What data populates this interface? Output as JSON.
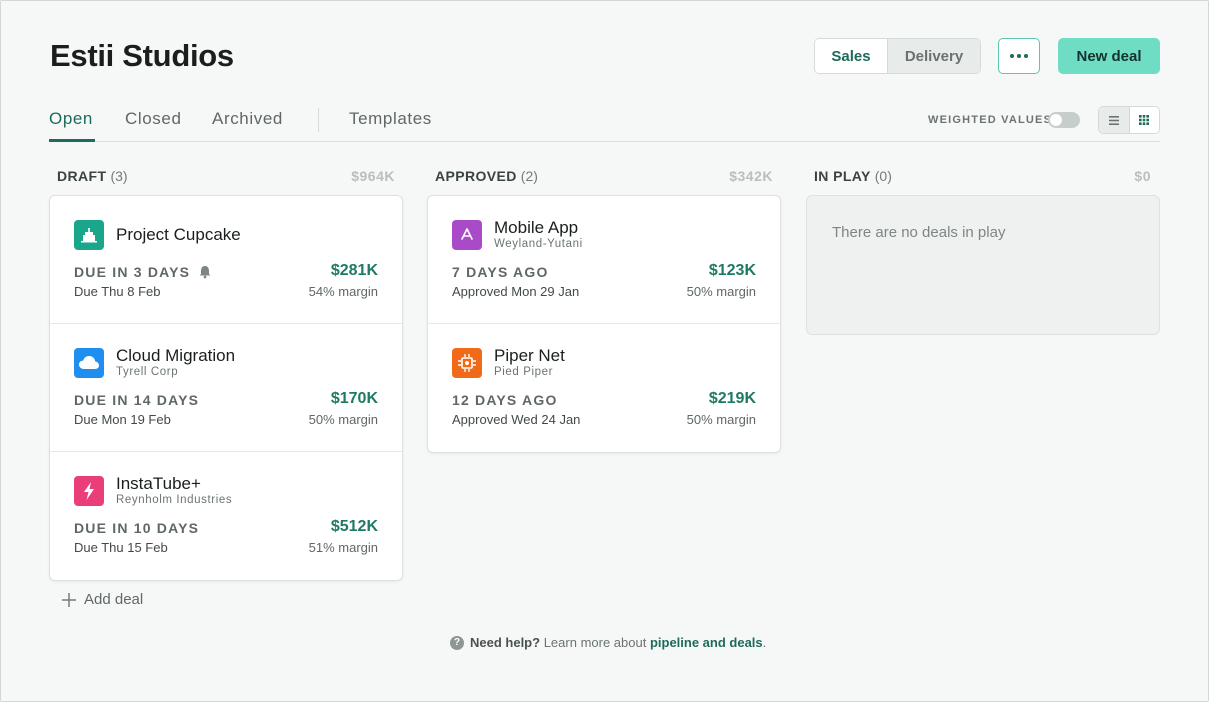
{
  "page": {
    "title": "Estii Studios"
  },
  "header": {
    "segments": [
      "Sales",
      "Delivery"
    ],
    "new_deal_label": "New deal"
  },
  "tabs": [
    "Open",
    "Closed",
    "Archived",
    "Templates"
  ],
  "view_options": {
    "weighted_label": "WEIGHTED VALUES",
    "weighted_on": false
  },
  "columns": [
    {
      "name": "DRAFT",
      "count": "(3)",
      "total": "$964K",
      "deals": [
        {
          "title": "Project Cupcake",
          "client": "",
          "due": "DUE IN 3 DAYS",
          "has_reminder": true,
          "date": "Due Thu 8 Feb",
          "amount": "$281K",
          "margin": "54% margin",
          "icon": "cake-icon",
          "color": "#1aa68a"
        },
        {
          "title": "Cloud Migration",
          "client": "Tyrell Corp",
          "due": "DUE IN 14 DAYS",
          "date": "Due Mon 19 Feb",
          "amount": "$170K",
          "margin": "50% margin",
          "icon": "cloud-icon",
          "color": "#1e8ef0"
        },
        {
          "title": "InstaTube+",
          "client": "Reynholm Industries",
          "due": "DUE IN 10 DAYS",
          "date": "Due Thu 15 Feb",
          "amount": "$512K",
          "margin": "51% margin",
          "icon": "bolt-icon",
          "color": "#ea3e7a"
        }
      ]
    },
    {
      "name": "APPROVED",
      "count": "(2)",
      "total": "$342K",
      "deals": [
        {
          "title": "Mobile App",
          "client": "Weyland-Yutani",
          "due": "7 DAYS AGO",
          "date": "Approved Mon 29 Jan",
          "amount": "$123K",
          "margin": "50% margin",
          "icon": "app-store-icon",
          "color": "#a94bc8"
        },
        {
          "title": "Piper Net",
          "client": "Pied Piper",
          "due": "12 DAYS AGO",
          "date": "Approved Wed 24 Jan",
          "amount": "$219K",
          "margin": "50% margin",
          "icon": "chip-icon",
          "color": "#f16a17"
        }
      ]
    },
    {
      "name": "IN PLAY",
      "count": "(0)",
      "total": "$0",
      "empty_text": "There are no deals in play"
    }
  ],
  "add_deal_label": "Add deal",
  "help": {
    "prefix": "Need help?",
    "text": "Learn more about",
    "link": "pipeline and deals",
    "suffix": "."
  }
}
